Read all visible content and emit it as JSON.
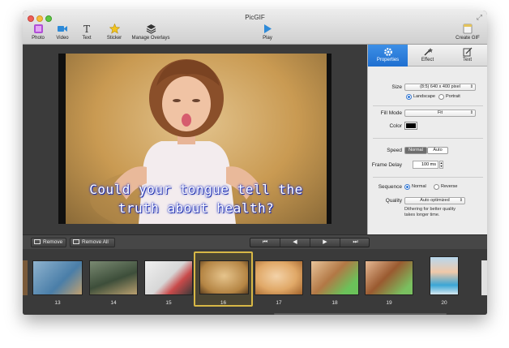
{
  "window": {
    "title": "PicGIF"
  },
  "toolbar": {
    "photo": "Photo",
    "video": "Video",
    "text": "Text",
    "sticker": "Sticker",
    "manage_overlays": "Manage Overlays",
    "play": "Play",
    "create_gif": "Create GIF"
  },
  "preview": {
    "caption_line1": "Could your tongue tell the",
    "caption_line2": "truth about health?"
  },
  "panel": {
    "tabs": [
      "Properties",
      "Effect",
      "Text"
    ],
    "size_label": "Size",
    "size_value": "(8:5) 640 x 400 pixel",
    "orientation": [
      "Landscape",
      "Portrait"
    ],
    "orientation_selected": "Landscape",
    "fill_mode_label": "Fill Mode",
    "fill_mode_value": "Fit",
    "color_label": "Color",
    "color_value": "#000000",
    "speed_label": "Speed",
    "speed_options": [
      "Normal",
      "Auto"
    ],
    "speed_selected": "Normal",
    "frame_delay_label": "Frame Delay",
    "frame_delay_value": "100 ms",
    "sequence_label": "Sequence",
    "sequence_options": [
      "Normal",
      "Reverse"
    ],
    "sequence_selected": "Normal",
    "quality_label": "Quality",
    "quality_value": "Auto optimized",
    "quality_hint_1": "Dithering for better quality",
    "quality_hint_2": "takes longer time."
  },
  "frame_bar": {
    "remove": "Remove",
    "remove_all": "Remove All",
    "nav": [
      "first-frame-icon",
      "prev-frame-icon",
      "next-frame-icon",
      "last-frame-icon"
    ]
  },
  "frames": {
    "numbers": [
      "13",
      "14",
      "15",
      "16",
      "17",
      "18",
      "19",
      "20"
    ],
    "selected": "16"
  },
  "colors": {
    "accent": "#1f6fd0",
    "selected_frame": "#d8b846",
    "caption_glow": "#2b3cc6"
  }
}
